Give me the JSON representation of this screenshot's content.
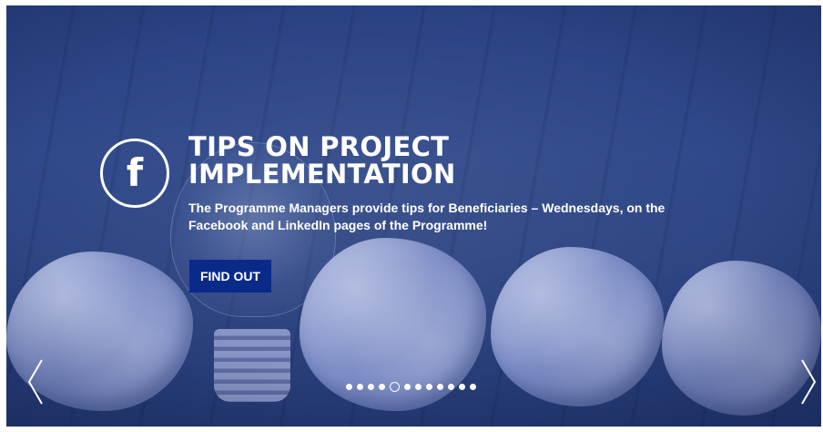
{
  "slide": {
    "icon": "facebook-icon",
    "icon_glyph": "f",
    "title_line1": "TIPS ON PROJECT",
    "title_line2": "IMPLEMENTATION",
    "description": "The Programme Managers provide tips for Beneficiaries – Wednesdays, on the Facebook and LinkedIn pages of the Programme!",
    "button_label": "FIND OUT"
  },
  "carousel": {
    "prev_icon": "chevron-left-icon",
    "next_icon": "chevron-right-icon",
    "dot_count": 12,
    "active_dot": 5
  },
  "colors": {
    "overlay": "#2e4684",
    "button": "#0a2a8a",
    "text": "#ffffff"
  }
}
